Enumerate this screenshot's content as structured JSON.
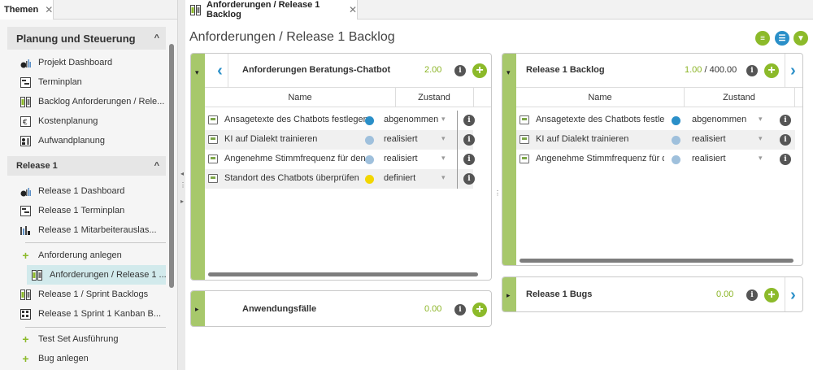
{
  "left_tab": {
    "label": "Themen",
    "close": "✕"
  },
  "main_tab": {
    "label": "Anforderungen / Release 1 Backlog",
    "close": "✕"
  },
  "sidebar": {
    "group1": {
      "title": "Planung und Steuerung",
      "chevron": "^"
    },
    "group1_items": [
      {
        "label": "Projekt Dashboard"
      },
      {
        "label": "Terminplan"
      },
      {
        "label": "Backlog Anforderungen / Rele..."
      },
      {
        "label": "Kostenplanung"
      },
      {
        "label": "Aufwandplanung"
      }
    ],
    "group2": {
      "title": "Release 1",
      "chevron": "^"
    },
    "group2_items": [
      {
        "label": "Release 1 Dashboard"
      },
      {
        "label": "Release 1 Terminplan"
      },
      {
        "label": "Release 1 Mitarbeiterauslas..."
      },
      {
        "label": "Anforderung anlegen"
      },
      {
        "label": "Anforderungen / Release 1 ..."
      },
      {
        "label": "Release 1 / Sprint Backlogs"
      },
      {
        "label": "Release 1 Sprint 1 Kanban B..."
      },
      {
        "label": "Test Set Ausführung"
      },
      {
        "label": "Bug anlegen"
      }
    ]
  },
  "page": {
    "title": "Anforderungen / Release 1 Backlog"
  },
  "cards": {
    "left_top": {
      "title": "Anforderungen Beratungs-Chatbot",
      "value": "2.00",
      "col_name": "Name",
      "col_state": "Zustand",
      "rows": [
        {
          "name": "Ansagetexte des Chatbots festlegen",
          "state": "abgenommen"
        },
        {
          "name": "KI auf Dialekt trainieren",
          "state": "realisiert"
        },
        {
          "name": "Angenehme Stimmfrequenz für den Chatbot",
          "state": "realisiert"
        },
        {
          "name": "Standort des Chatbots überprüfen",
          "state": "definiert"
        }
      ]
    },
    "left_bottom": {
      "title": "Anwendungsfälle",
      "value": "0.00"
    },
    "right_top": {
      "title": "Release 1 Backlog",
      "value": "1.00",
      "total": " / 400.00",
      "col_name": "Name",
      "col_state": "Zustand",
      "rows": [
        {
          "name": "Ansagetexte des Chatbots festlegen",
          "state": "abgenommen"
        },
        {
          "name": "KI auf Dialekt trainieren",
          "state": "realisiert"
        },
        {
          "name": "Angenehme Stimmfrequenz für den Chatbot",
          "state": "realisiert"
        }
      ]
    },
    "right_bottom": {
      "title": "Release 1 Bugs",
      "value": "0.00"
    }
  },
  "colors": {
    "accent_green": "#8cba2a",
    "strip_green": "#a7c86b",
    "state_abgenommen": "#2a8fc8",
    "state_realisiert": "#9fc0dc",
    "state_definiert": "#f2d600",
    "selection": "#d2eaec"
  },
  "icons": {
    "info": "i",
    "add": "+",
    "dropdown": "▾",
    "collapse": "▾",
    "expand": "▸",
    "nav_left": "‹",
    "nav_right": "›"
  }
}
